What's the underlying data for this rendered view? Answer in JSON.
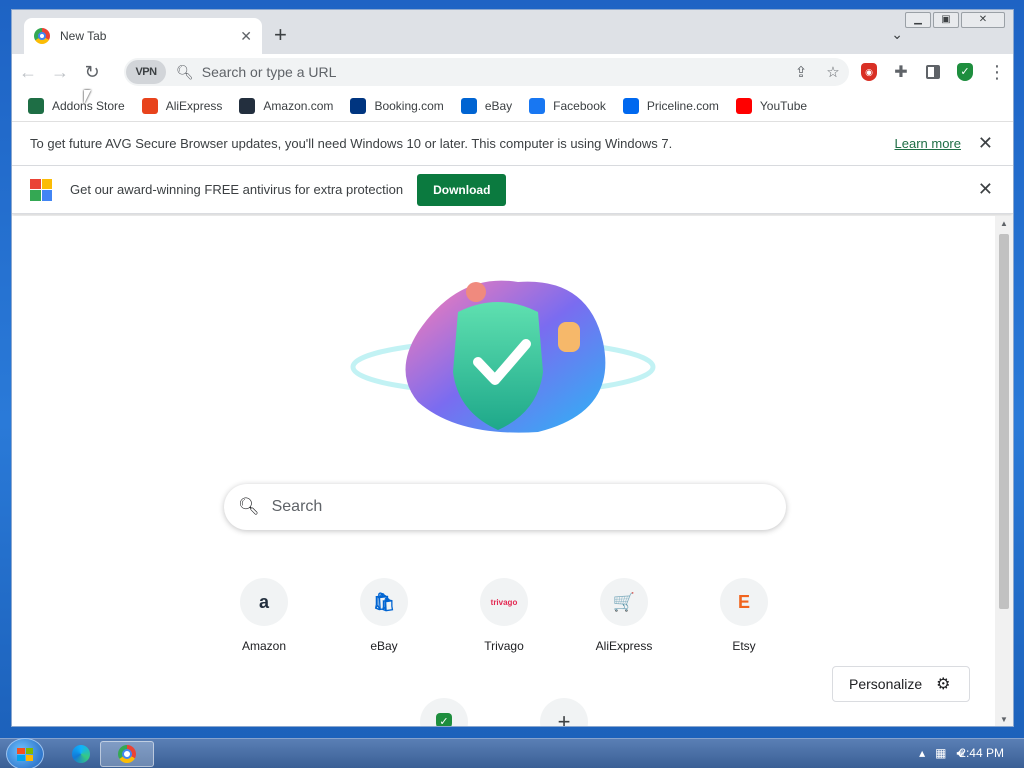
{
  "window": {
    "tab_title": "New Tab",
    "omnibox_placeholder": "Search or type a URL",
    "vpn_label": "VPN"
  },
  "bookmarks": [
    {
      "label": "Addons Store",
      "icon": "addons-store-icon",
      "color": "#1e6e45"
    },
    {
      "label": "AliExpress",
      "icon": "aliexpress-icon",
      "color": "#e8431c"
    },
    {
      "label": "Amazon.com",
      "icon": "amazon-icon",
      "color": "#232f3e"
    },
    {
      "label": "Booking.com",
      "icon": "booking-icon",
      "color": "#003580"
    },
    {
      "label": "eBay",
      "icon": "ebay-icon",
      "color": "#0064d2"
    },
    {
      "label": "Facebook",
      "icon": "facebook-icon",
      "color": "#1877f2"
    },
    {
      "label": "Priceline.com",
      "icon": "priceline-icon",
      "color": "#0068ef"
    },
    {
      "label": "YouTube",
      "icon": "youtube-icon",
      "color": "#ff0000"
    }
  ],
  "infobars": {
    "update_notice": "To get future AVG Secure Browser updates, you'll need Windows 10 or later. This computer is using Windows 7.",
    "learn_more": "Learn more",
    "antivirus_promo": "Get our award-winning FREE antivirus for extra protection",
    "download_label": "Download"
  },
  "newtab": {
    "search_placeholder": "Search",
    "tiles": [
      {
        "label": "Amazon",
        "glyph": "a",
        "color": "#232f3e"
      },
      {
        "label": "eBay",
        "glyph": "🛍",
        "color": "#0064d2"
      },
      {
        "label": "Trivago",
        "glyph": "trivago",
        "color": "#e32851"
      },
      {
        "label": "AliExpress",
        "glyph": "🛒",
        "color": "#e8431c"
      },
      {
        "label": "Etsy",
        "glyph": "E",
        "color": "#f1641e"
      }
    ],
    "personalize_label": "Personalize"
  },
  "taskbar": {
    "clock": "2:44 PM"
  },
  "colors": {
    "accent_green": "#0b7a3f",
    "link_green": "#1e6e45"
  }
}
